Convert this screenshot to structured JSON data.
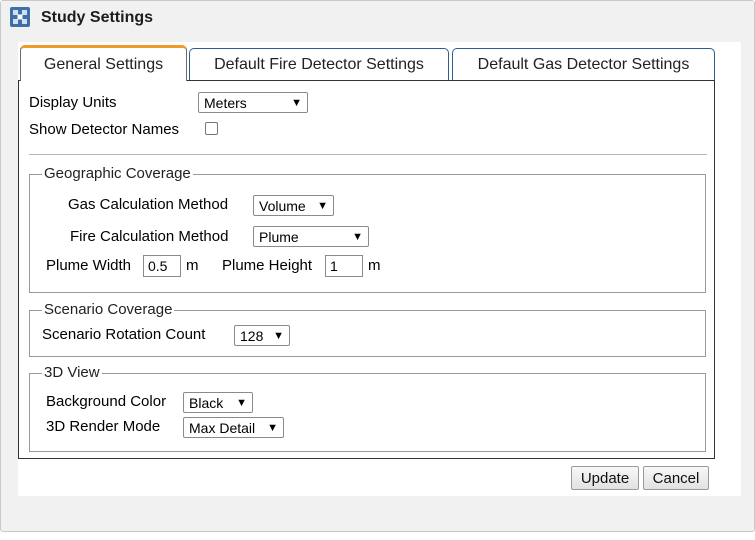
{
  "window": {
    "title": "Study Settings",
    "icon": "app-icon"
  },
  "tabs": [
    {
      "label": "General Settings",
      "active": true
    },
    {
      "label": "Default Fire Detector Settings",
      "active": false
    },
    {
      "label": "Default Gas Detector Settings",
      "active": false
    }
  ],
  "general": {
    "display_units_label": "Display Units",
    "display_units_value": "Meters",
    "show_names_label": "Show Detector Names",
    "show_names_checked": false
  },
  "geographic": {
    "legend": "Geographic Coverage",
    "gas_method_label": "Gas Calculation Method",
    "gas_method_value": "Volume",
    "fire_method_label": "Fire Calculation Method",
    "fire_method_value": "Plume",
    "plume_width_label": "Plume Width",
    "plume_width_value": "0.5",
    "plume_width_unit": "m",
    "plume_height_label": "Plume Height",
    "plume_height_value": "1",
    "plume_height_unit": "m"
  },
  "scenario": {
    "legend": "Scenario Coverage",
    "rotation_label": "Scenario Rotation Count",
    "rotation_value": "128"
  },
  "view3d": {
    "legend": "3D View",
    "bg_color_label": "Background Color",
    "bg_color_value": "Black",
    "render_mode_label": "3D Render Mode",
    "render_mode_value": "Max Detail"
  },
  "buttons": {
    "update": "Update",
    "cancel": "Cancel"
  },
  "colors": {
    "active_tab_accent": "#f09a2c",
    "tab_border": "#2e5c8e",
    "icon": "#3e6fa8"
  }
}
